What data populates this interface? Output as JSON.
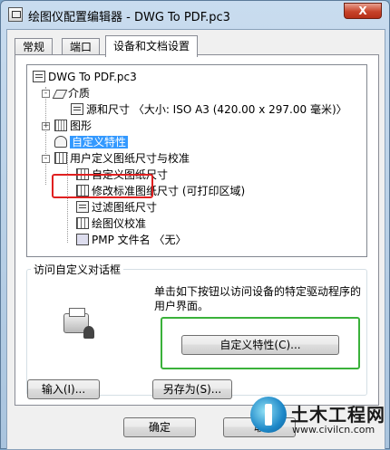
{
  "window": {
    "title": "绘图仪配置编辑器 - DWG To PDF.pc3",
    "close_label": "X"
  },
  "tabs": [
    "常规",
    "端口",
    "设备和文档设置"
  ],
  "tree": {
    "items": [
      "DWG To PDF.pc3",
      "介质",
      "源和尺寸 〈大小: ISO A3 (420.00 x 297.00 毫米)〉",
      "图形",
      "自定义特性",
      "用户定义图纸尺寸与校准",
      "自定义图纸尺寸",
      "修改标准图纸尺寸 (可打印区域)",
      "过滤图纸尺寸",
      "绘图仪校准",
      "PMP 文件名 〈无〉"
    ],
    "expanders": [
      "-",
      "+",
      "-"
    ]
  },
  "group": {
    "title": "访问自定义对话框",
    "description": "单击如下按钮以访问设备的特定驱动程序的用户界面。",
    "custom_button": "自定义特性(C)..."
  },
  "bottom": {
    "import_button": "输入(I)...",
    "saveas_button": "另存为(S)...",
    "ok_button": "确定",
    "cancel_button": "取"
  },
  "watermark": {
    "name": "土木工程网",
    "url": "www.civilcn.com"
  },
  "colors": {
    "selection": "#3399ff",
    "annotation_red": "#e02020",
    "annotation_green": "#3ab13a"
  }
}
